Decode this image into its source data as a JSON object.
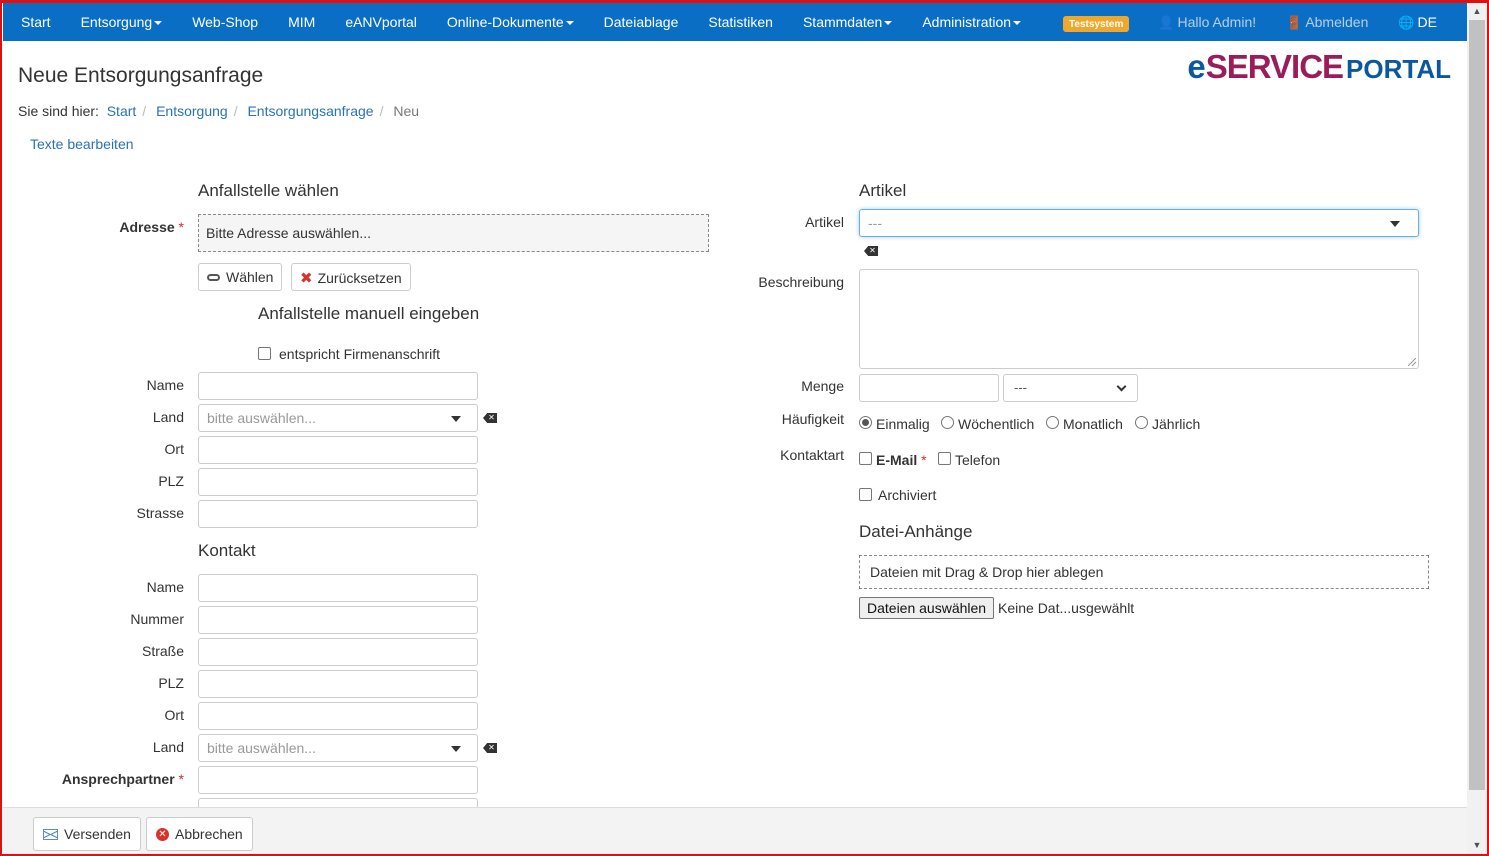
{
  "navbar": {
    "items": [
      {
        "label": "Start",
        "dropdown": false
      },
      {
        "label": "Entsorgung",
        "dropdown": true
      },
      {
        "label": "Web-Shop",
        "dropdown": false
      },
      {
        "label": "MIM",
        "dropdown": false
      },
      {
        "label": "eANVportal",
        "dropdown": false
      },
      {
        "label": "Online-Dokumente",
        "dropdown": true
      },
      {
        "label": "Dateiablage",
        "dropdown": false
      },
      {
        "label": "Statistiken",
        "dropdown": false
      },
      {
        "label": "Stammdaten",
        "dropdown": true
      },
      {
        "label": "Administration",
        "dropdown": true
      }
    ],
    "badge": "Testsystem",
    "greeting": "Hallo Admin!",
    "logout": "Abmelden",
    "language": "DE",
    "bg_color": "#0a6fc4"
  },
  "logo": {
    "e": "e",
    "service": "SERVICE",
    "portal": "PORTAL"
  },
  "page": {
    "title": "Neue Entsorgungsanfrage",
    "edit_texts": "Texte bearbeiten"
  },
  "breadcrumb": {
    "prefix": "Sie sind hier:",
    "items": [
      "Start",
      "Entsorgung",
      "Entsorgungsanfrage"
    ],
    "current": "Neu"
  },
  "left": {
    "choose_title": "Anfallstelle wählen",
    "address_label": "Adresse",
    "address_placeholder": "Bitte Adresse auswählen...",
    "choose_button": "Wählen",
    "reset_button": "Zurücksetzen",
    "manual_title": "Anfallstelle manuell eingeben",
    "same_as_company": "entspricht Firmenanschrift",
    "manual_fields": {
      "name": "Name",
      "country": "Land",
      "city": "Ort",
      "zip": "PLZ",
      "street": "Strasse"
    },
    "country_placeholder": "bitte auswählen...",
    "contact_title": "Kontakt",
    "contact_fields": {
      "name": "Name",
      "number": "Nummer",
      "street": "Straße",
      "zip": "PLZ",
      "city": "Ort",
      "country": "Land",
      "contact_person": "Ansprechpartner"
    },
    "required_mark": "*"
  },
  "right": {
    "article_title": "Artikel",
    "article_label": "Artikel",
    "article_value": "---",
    "description_label": "Beschreibung",
    "quantity_label": "Menge",
    "unit_value": "---",
    "frequency_label": "Häufigkeit",
    "frequency_options": [
      "Einmalig",
      "Wöchentlich",
      "Monatlich",
      "Jährlich"
    ],
    "frequency_selected": "Einmalig",
    "contact_type_label": "Kontaktart",
    "contact_email": "E-Mail",
    "contact_phone": "Telefon",
    "archived": "Archiviert",
    "attachments_title": "Datei-Anhänge",
    "dropzone": "Dateien mit Drag & Drop hier ablegen",
    "file_button": "Dateien auswählen",
    "file_status": "Keine Dat...usgewählt"
  },
  "footer": {
    "send": "Versenden",
    "cancel": "Abbrechen"
  }
}
